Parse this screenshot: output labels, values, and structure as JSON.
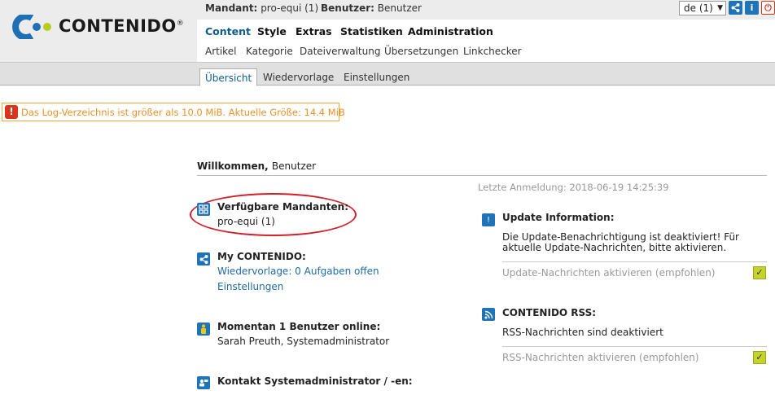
{
  "logo": {
    "text": "CONTENIDO",
    "reg": "®"
  },
  "info_bar": {
    "mandant_label": "Mandant:",
    "mandant_value": "pro-equi (1)",
    "benutzer_label": "Benutzer:",
    "benutzer_value": "Benutzer",
    "language": "de (1)"
  },
  "main_nav": [
    "Content",
    "Style",
    "Extras",
    "Statistiken",
    "Administration"
  ],
  "sub_nav": [
    "Artikel",
    "Kategorie",
    "Dateiverwaltung",
    "Übersetzungen",
    "Linkchecker"
  ],
  "tabs": [
    "Übersicht",
    "Wiedervorlage",
    "Einstellungen"
  ],
  "warning": {
    "text": "Das Log-Verzeichnis ist größer als 10.0 MiB. Aktuelle Größe: 14.4 MiB"
  },
  "welcome": {
    "label": "Willkommen,",
    "user": "Benutzer",
    "last_login": "Letzte Anmeldung: 2018-06-19 14:25:39"
  },
  "left": {
    "mandanten_title": "Verfügbare Mandanten:",
    "mandanten_value": "pro-equi (1)",
    "my_title": "My CONTENIDO:",
    "my_link1": "Wiedervorlage: 0 Aufgaben offen",
    "my_link2": "Einstellungen",
    "online_title": "Momentan 1 Benutzer online:",
    "online_value": "Sarah Preuth, Systemadministrator",
    "kontakt_title": "Kontakt Systemadministrator / -en:"
  },
  "right": {
    "update_title": "Update Information:",
    "update_text1": "Die Update-Benachrichtigung ist deaktiviert! Für",
    "update_text2": "aktuelle Update-Nachrichten, bitte aktivieren.",
    "update_check": "Update-Nachrichten aktivieren (empfohlen)",
    "rss_title": "CONTENIDO RSS:",
    "rss_text": "RSS-Nachrichten sind deaktiviert",
    "rss_check": "RSS-Nachrichten aktivieren (empfohlen)"
  },
  "icons": {
    "warning": "exclamation-icon",
    "mandanten": "grid-icon",
    "my": "share-icon",
    "online": "user-icon",
    "kontakt": "contact-icon",
    "update": "info-bubble-icon",
    "rss": "rss-icon"
  },
  "colors": {
    "accent": "#1f73b7",
    "warning": "#e8912a",
    "highlight": "#d21f2a",
    "check": "#c5d42a"
  }
}
